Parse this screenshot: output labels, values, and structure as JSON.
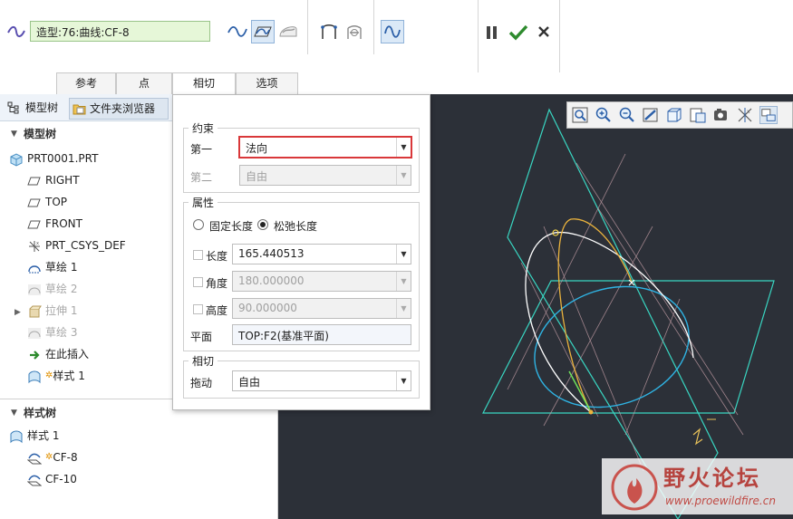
{
  "toolbar": {
    "curve_name": "造型:76:曲线:CF-8",
    "icons": [
      "curve-free-icon",
      "curve-planar-icon",
      "curve-on-surface-icon",
      "curve-offset-icon",
      "curve-cos-icon",
      "curve-display-icon"
    ]
  },
  "actions": {
    "pause": "pause-icon",
    "ok": "check-icon",
    "cancel": "close-icon"
  },
  "tabs": [
    {
      "label": "参考"
    },
    {
      "label": "点"
    },
    {
      "label": "相切"
    },
    {
      "label": "选项"
    }
  ],
  "left_panel": {
    "tabs": [
      {
        "label": "模型树"
      },
      {
        "label": "文件夹浏览器"
      }
    ],
    "model_tree": {
      "title": "模型树",
      "items": [
        {
          "label": "PRT0001.PRT"
        },
        {
          "label": "RIGHT"
        },
        {
          "label": "TOP"
        },
        {
          "label": "FRONT"
        },
        {
          "label": "PRT_CSYS_DEF"
        },
        {
          "label": "草绘 1"
        },
        {
          "label": "草绘 2"
        },
        {
          "label": "拉伸 1"
        },
        {
          "label": "草绘 3"
        },
        {
          "label": "在此插入"
        },
        {
          "label": "样式 1"
        }
      ]
    },
    "style_tree": {
      "title": "样式树",
      "items": [
        {
          "label": "样式 1"
        },
        {
          "label": "CF-8"
        },
        {
          "label": "CF-10"
        }
      ]
    }
  },
  "tangent_panel": {
    "constraint": {
      "title": "约束",
      "first_label": "第一",
      "first_value": "法向",
      "second_label": "第二",
      "second_value": "自由"
    },
    "properties": {
      "title": "属性",
      "radio_fixed": "固定长度",
      "radio_relaxed": "松弛长度",
      "length_label": "长度",
      "length_value": "165.440513",
      "angle_label": "角度",
      "angle_value": "180.000000",
      "height_label": "高度",
      "height_value": "90.000000",
      "plane_label": "平面",
      "plane_value": "TOP:F2(基准平面)"
    },
    "tangent": {
      "title": "相切",
      "drag_label": "拖动",
      "drag_value": "自由"
    }
  },
  "viewport": {
    "toolbar_icons": [
      "refit-icon",
      "zoom-in-icon",
      "zoom-out-icon",
      "repaint-icon",
      "display-style-icon",
      "saved-views-icon",
      "view-manager-icon",
      "datum-display-icon",
      "style-display-icon"
    ],
    "watermark": {
      "title": "野火论坛",
      "url": "www.proewildfire.cn"
    }
  }
}
